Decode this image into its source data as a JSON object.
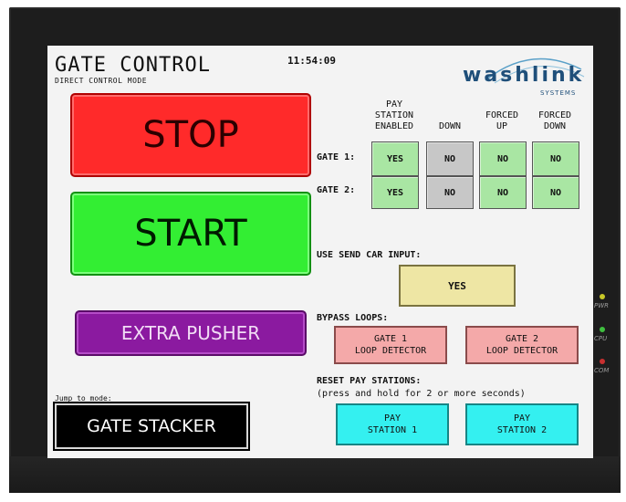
{
  "header": {
    "title": "GATE CONTROL",
    "subtitle": "DIRECT CONTROL MODE",
    "time": "11:54:09",
    "logo": "washlink",
    "logo_sub": "SYSTEMS"
  },
  "buttons": {
    "stop": "STOP",
    "start": "START",
    "extra_pusher": "EXTRA PUSHER"
  },
  "jump": {
    "label": "Jump to mode:",
    "mode": "GATE STACKER"
  },
  "gate_table": {
    "columns": [
      {
        "line1": "PAY",
        "line2": "STATION",
        "line3": "ENABLED"
      },
      {
        "line1": "",
        "line2": "",
        "line3": "DOWN"
      },
      {
        "line1": "",
        "line2": "FORCED",
        "line3": "UP"
      },
      {
        "line1": "",
        "line2": "FORCED",
        "line3": "DOWN"
      }
    ],
    "rows": [
      {
        "label": "GATE 1:",
        "values": [
          "YES",
          "NO",
          "NO",
          "NO"
        ]
      },
      {
        "label": "GATE 2:",
        "values": [
          "YES",
          "NO",
          "NO",
          "NO"
        ]
      }
    ]
  },
  "send_car": {
    "label": "USE SEND CAR INPUT:",
    "value": "YES"
  },
  "bypass": {
    "label": "BYPASS LOOPS:",
    "gate1_l1": "GATE 1",
    "gate1_l2": "LOOP DETECTOR",
    "gate2_l1": "GATE 2",
    "gate2_l2": "LOOP DETECTOR"
  },
  "reset": {
    "label": "RESET PAY STATIONS:",
    "hint": "(press and hold for 2 or more seconds)",
    "ps1_l1": "PAY",
    "ps1_l2": "STATION 1",
    "ps2_l1": "PAY",
    "ps2_l2": "STATION 2"
  },
  "indicators": {
    "pwr": "PWR",
    "cpu": "CPU",
    "com": "COM"
  },
  "colors": {
    "stop": "#ff2a2a",
    "start": "#33ee33",
    "extra": "#8b1aa0",
    "toggle_on": "#a9e6a3",
    "toggle_off": "#c7c7c7",
    "send_car": "#eee6a4",
    "bypass": "#f4a9a9",
    "reset": "#34f0f0"
  }
}
